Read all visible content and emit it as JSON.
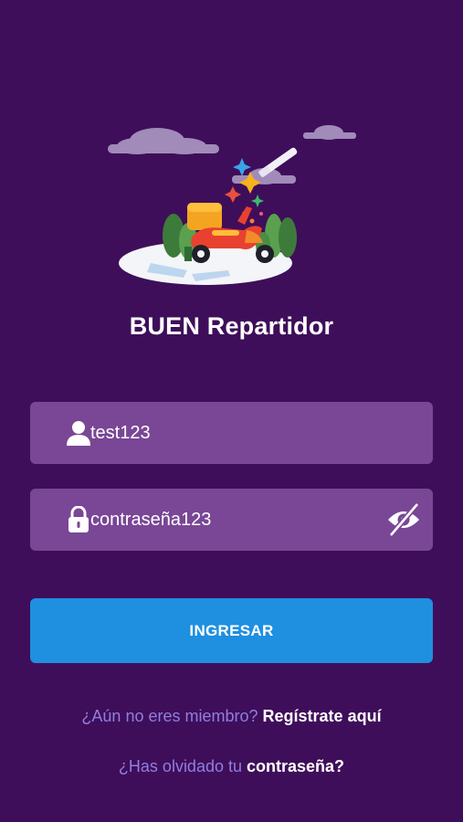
{
  "app": {
    "title": "BUEN Repartidor"
  },
  "form": {
    "username_value": "test123",
    "password_value": "contraseña123",
    "login_label": "INGRESAR"
  },
  "links": {
    "register_prompt": "¿Aún no eres miembro?",
    "register_action": "Regístrate aquí",
    "forgot_prompt": "¿Has olvidado tu",
    "forgot_action": "contraseña?"
  },
  "icons": {
    "user": "user-icon",
    "lock": "lock-icon",
    "visibility": "eye-off-icon"
  },
  "colors": {
    "background": "#3f0e5a",
    "field": "#7a4696",
    "button": "#1f8fe0",
    "link_muted": "#8f7fe0"
  }
}
